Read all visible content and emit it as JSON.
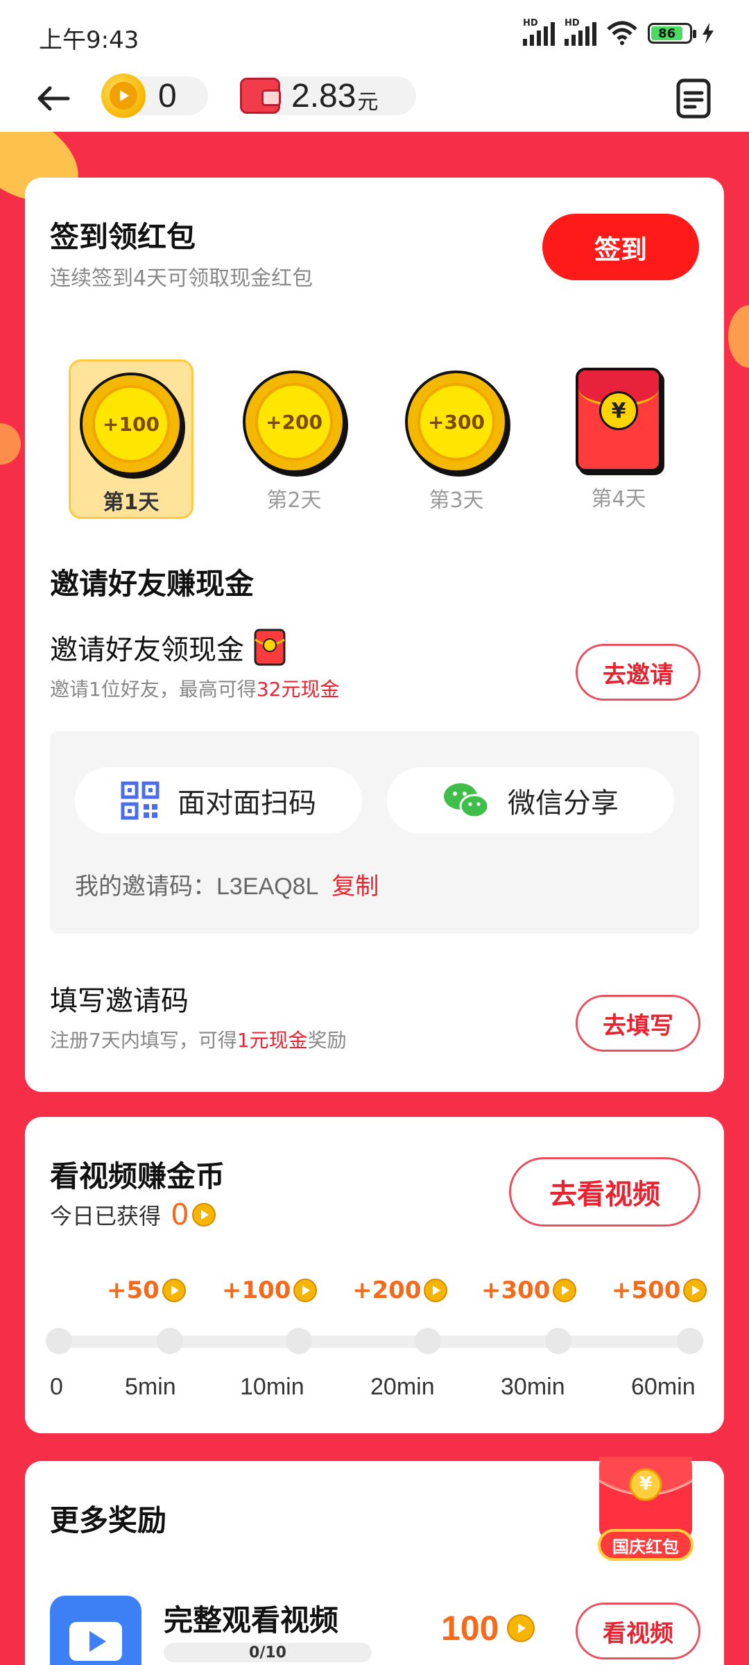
{
  "status_bar": {
    "time": "上午9:43",
    "hd1": "HD",
    "hd2": "HD",
    "battery": "86"
  },
  "header": {
    "coins": "0",
    "cash": "2.83",
    "cash_unit": "元"
  },
  "signin": {
    "title": "签到领红包",
    "subtitle": "连续签到4天可领取现金红包",
    "button": "签到",
    "days": [
      {
        "amount": "+100",
        "label": "第1天"
      },
      {
        "amount": "+200",
        "label": "第2天"
      },
      {
        "amount": "+300",
        "label": "第3天"
      },
      {
        "amount": "¥",
        "label": "第4天"
      }
    ]
  },
  "invite": {
    "title": "邀请好友赚现金",
    "item1_title": "邀请好友领现金",
    "item1_sub_prefix": "邀请1位好友，最高可得",
    "item1_sub_highlight": "32元现金",
    "item1_button": "去邀请",
    "scan_label": "面对面扫码",
    "wechat_label": "微信分享",
    "code_label": "我的邀请码：",
    "code": "L3EAQ8L",
    "copy": "复制",
    "item2_title": "填写邀请码",
    "item2_sub_prefix": "注册7天内填写，可得",
    "item2_sub_highlight": "1元现金",
    "item2_sub_suffix": "奖励",
    "item2_button": "去填写"
  },
  "video": {
    "title": "看视频赚金币",
    "today_label": "今日已获得",
    "today_value": "0",
    "button": "去看视频",
    "rewards": [
      "+50",
      "+100",
      "+200",
      "+300",
      "+500"
    ],
    "ticks": [
      "0",
      "5min",
      "10min",
      "20min",
      "30min",
      "60min"
    ],
    "progress": 0
  },
  "more": {
    "title": "更多奖励",
    "badge": "国庆红包",
    "badge_symbol": "¥",
    "task_title": "完整观看视频",
    "task_progress": "0/10",
    "task_reward": "100",
    "task_button": "看视频"
  },
  "colors": {
    "primary_red": "#f62e47",
    "accent_orange": "#f56a1a",
    "button_red": "#ff1a1a"
  }
}
